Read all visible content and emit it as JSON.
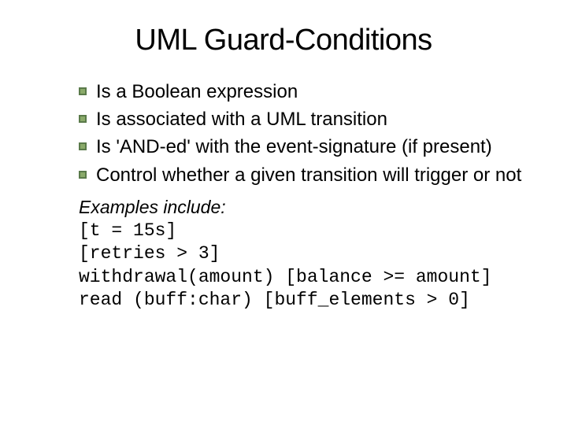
{
  "title": "UML Guard-Conditions",
  "bullets": {
    "item0": "Is a Boolean expression",
    "item1": "Is associated with a UML transition",
    "item2": "Is 'AND-ed' with the event-signature (if present)",
    "item3": "Control whether a given transition will trigger or not"
  },
  "examples_label": "Examples include:",
  "examples": {
    "line0": "[t = 15s]",
    "line1": "[retries > 3]",
    "line2": "withdrawal(amount) [balance >= amount]",
    "line3": "read (buff:char) [buff_elements > 0]"
  }
}
